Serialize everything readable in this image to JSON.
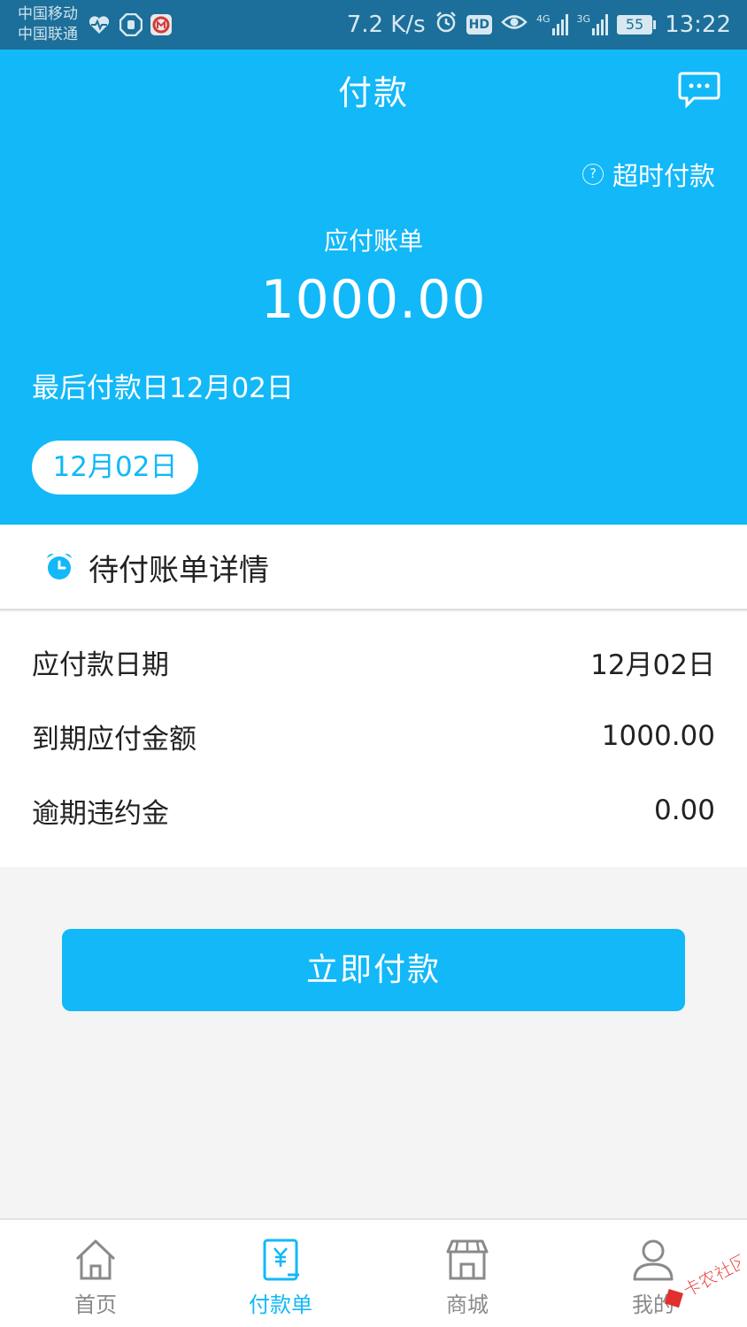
{
  "status_bar": {
    "carrier_1": "中国移动",
    "carrier_2": "中国联通",
    "net_speed": "7.2 K/s",
    "hd_badge": "HD",
    "network_1": "4G",
    "network_2": "3G",
    "battery": "55",
    "time": "13:22",
    "icons": [
      "heart-pulse-icon",
      "stop-hand-icon",
      "bank-logo-icon",
      "alarm-icon",
      "hd-icon",
      "eye-icon",
      "signal-icon",
      "battery-icon"
    ]
  },
  "header": {
    "title": "付款",
    "overtime_help": "?",
    "overtime_label": "超时付款",
    "bill_label": "应付账单",
    "amount": "1000.00",
    "last_pay_day": "最后付款日12月02日",
    "date_pill": "12月02日",
    "accent_color": "#12b8f8"
  },
  "details": {
    "section_title": "待付账单详情",
    "rows": [
      {
        "label": "应付款日期",
        "value": "12月02日"
      },
      {
        "label": "到期应付金额",
        "value": "1000.00"
      },
      {
        "label": "逾期违约金",
        "value": "0.00"
      }
    ]
  },
  "pay_button": {
    "label": "立即付款"
  },
  "bottom_nav": {
    "items": [
      {
        "label": "首页",
        "icon": "home-icon",
        "active": false
      },
      {
        "label": "付款单",
        "icon": "payment-bill-icon",
        "active": true
      },
      {
        "label": "商城",
        "icon": "store-icon",
        "active": false
      },
      {
        "label": "我的",
        "icon": "user-icon",
        "active": false
      }
    ]
  },
  "watermark": {
    "text": "卡农社区"
  }
}
